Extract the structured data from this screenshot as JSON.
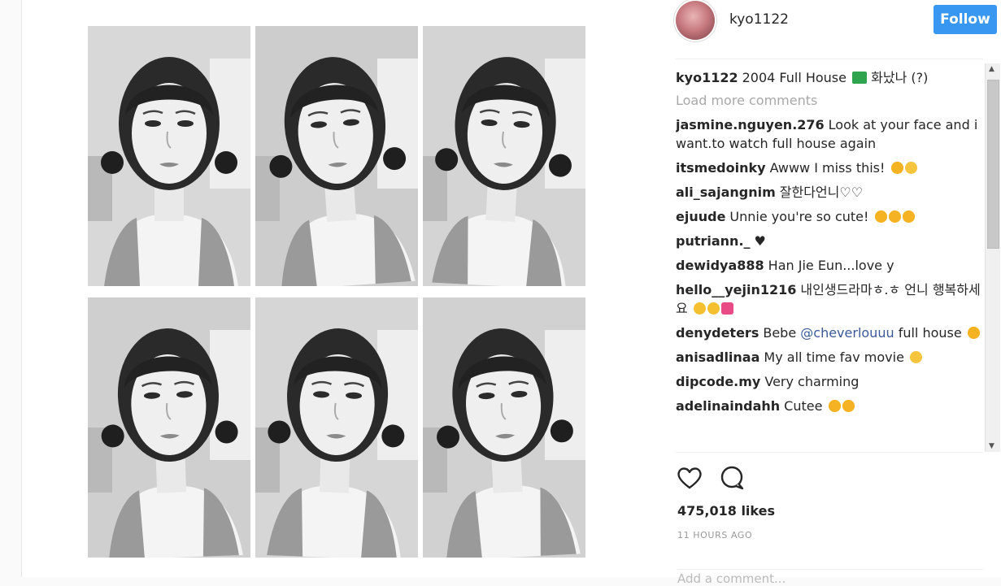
{
  "header": {
    "username": "kyo1122",
    "follow_label": "Follow"
  },
  "caption": {
    "user": "kyo1122",
    "text": "2004 Full House",
    "suffix": "화났나 (?)"
  },
  "load_more": "Load more comments",
  "comments": [
    {
      "user": "jasmine.nguyen.276",
      "text": "Look at your face and i want.to watch full house again",
      "emojis": []
    },
    {
      "user": "itsmedoinky",
      "text": "Awww I miss this!",
      "emojis": [
        "heart-eyes",
        "kiss"
      ]
    },
    {
      "user": "ali_sajangnim",
      "text": "잘한다언니♡♡",
      "emojis": []
    },
    {
      "user": "ejuude",
      "text": "Unnie you're so cute!",
      "emojis": [
        "heart-eyes",
        "heart-eyes",
        "heart-eyes"
      ]
    },
    {
      "user": "putriann._",
      "text": "♥",
      "emojis": []
    },
    {
      "user": "dewidya888",
      "text": "Han Jie Eun...love y",
      "emojis": []
    },
    {
      "user": "hello__yejin1216",
      "text": "내인생드라마ㅎ.ㅎ 언니 행복하세요",
      "emojis": [
        "crying",
        "crying",
        "sparkling-heart"
      ]
    },
    {
      "user": "denydeters",
      "text": "Bebe",
      "mention": "@cheverlouuu",
      "text_after": "full house",
      "emojis": [
        "heart-eyes"
      ]
    },
    {
      "user": "anisadlinaa",
      "text": "My all time fav movie",
      "emojis": [
        "kiss"
      ]
    },
    {
      "user": "dipcode.my",
      "text": "Very charming",
      "emojis": []
    },
    {
      "user": "adelinaindahh",
      "text": "Cutee",
      "emojis": [
        "heart-eyes",
        "heart-eyes"
      ]
    }
  ],
  "actions": {
    "like_icon": "heart-icon",
    "comment_icon": "comment-icon"
  },
  "likes": "475,018 likes",
  "timestamp": "11 HOURS AGO",
  "add_comment_placeholder": "Add a comment...",
  "colors": {
    "follow_button": "#3897f0",
    "mention": "#3b5998",
    "muted": "#a8a8a8"
  }
}
